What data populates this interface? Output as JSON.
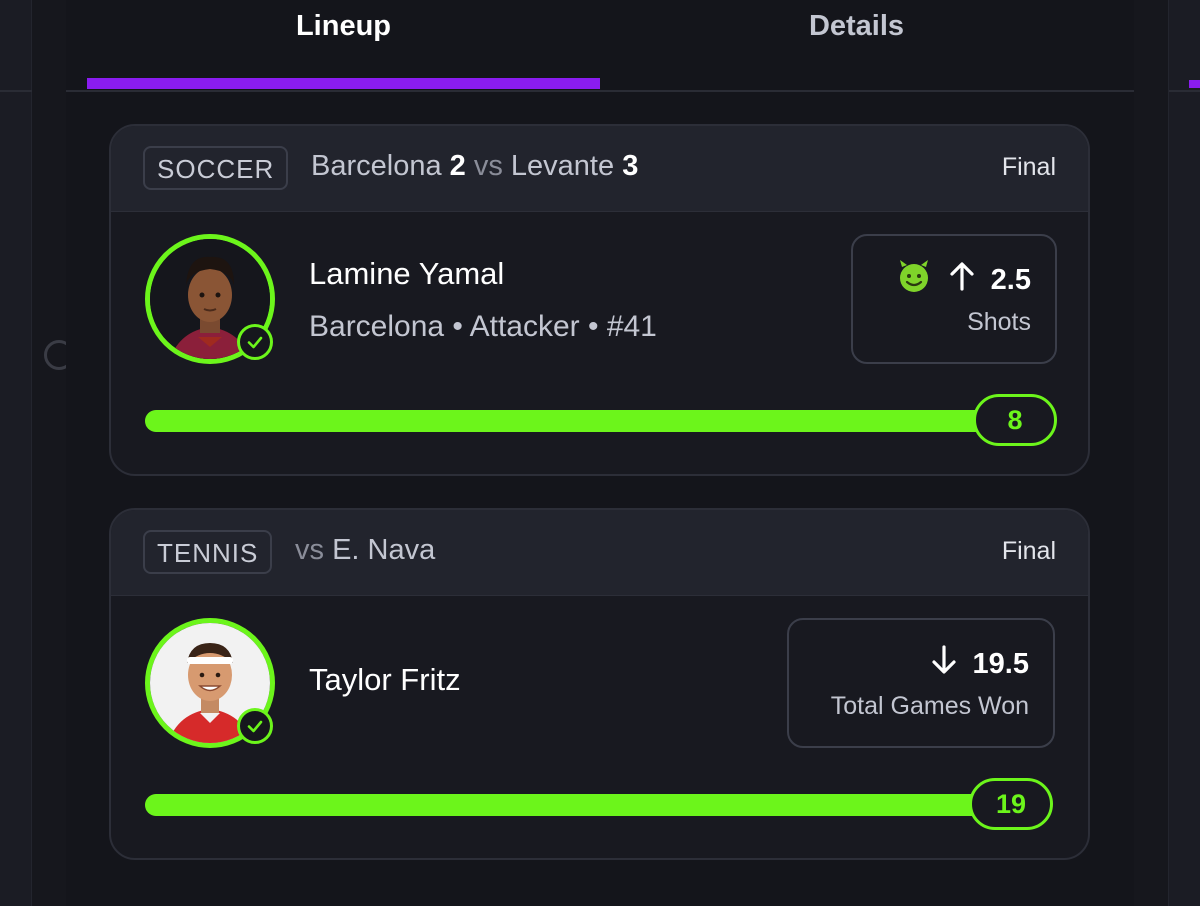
{
  "tabs": [
    {
      "label": "Lineup",
      "active": true
    },
    {
      "label": "Details",
      "active": false
    }
  ],
  "colors": {
    "accent_purple": "#8a1cf0",
    "accent_green": "#6cf51b",
    "background": "#16171d",
    "card": "#181920"
  },
  "picks": [
    {
      "sport": "SOCCER",
      "matchup": {
        "team1": "Barcelona",
        "score1": "2",
        "vs": "vs",
        "team2": "Levante",
        "score2": "3"
      },
      "status": "Final",
      "player": {
        "name": "Lamine Yamal",
        "meta": "Barcelona • Attacker • #41",
        "verified": true
      },
      "pick": {
        "icon": "devil-emoji-icon",
        "direction": "up-arrow-icon",
        "line": "2.5",
        "stat": "Shots"
      },
      "result": {
        "value": "8",
        "progress": 1.0
      }
    },
    {
      "sport": "TENNIS",
      "matchup": {
        "vs": "vs",
        "opponent": "E. Nava"
      },
      "status": "Final",
      "player": {
        "name": "Taylor Fritz",
        "verified": true
      },
      "pick": {
        "direction": "down-arrow-icon",
        "line": "19.5",
        "stat": "Total Games Won"
      },
      "result": {
        "value": "19",
        "progress": 1.0
      }
    }
  ]
}
